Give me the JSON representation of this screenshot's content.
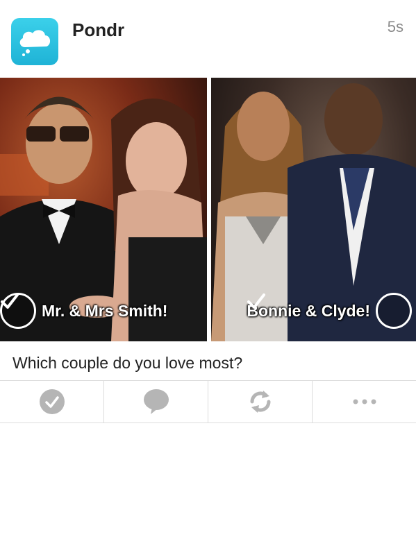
{
  "header": {
    "app_name": "Pondr",
    "time": "5s",
    "icon": "cloud-icon"
  },
  "poll": {
    "options": [
      {
        "label": "Mr. & Mrs Smith!"
      },
      {
        "label": "Bonnie & Clyde!"
      }
    ],
    "question": "Which couple do you love most?"
  },
  "actions": [
    {
      "name": "vote",
      "icon": "check-icon"
    },
    {
      "name": "comment",
      "icon": "speech-bubble-icon"
    },
    {
      "name": "repost",
      "icon": "refresh-icon"
    },
    {
      "name": "more",
      "icon": "more-dots-icon"
    }
  ],
  "colors": {
    "app_icon": "#2cc3e0",
    "action_icon": "#b5b5b5",
    "divider": "#dcdcdc"
  }
}
